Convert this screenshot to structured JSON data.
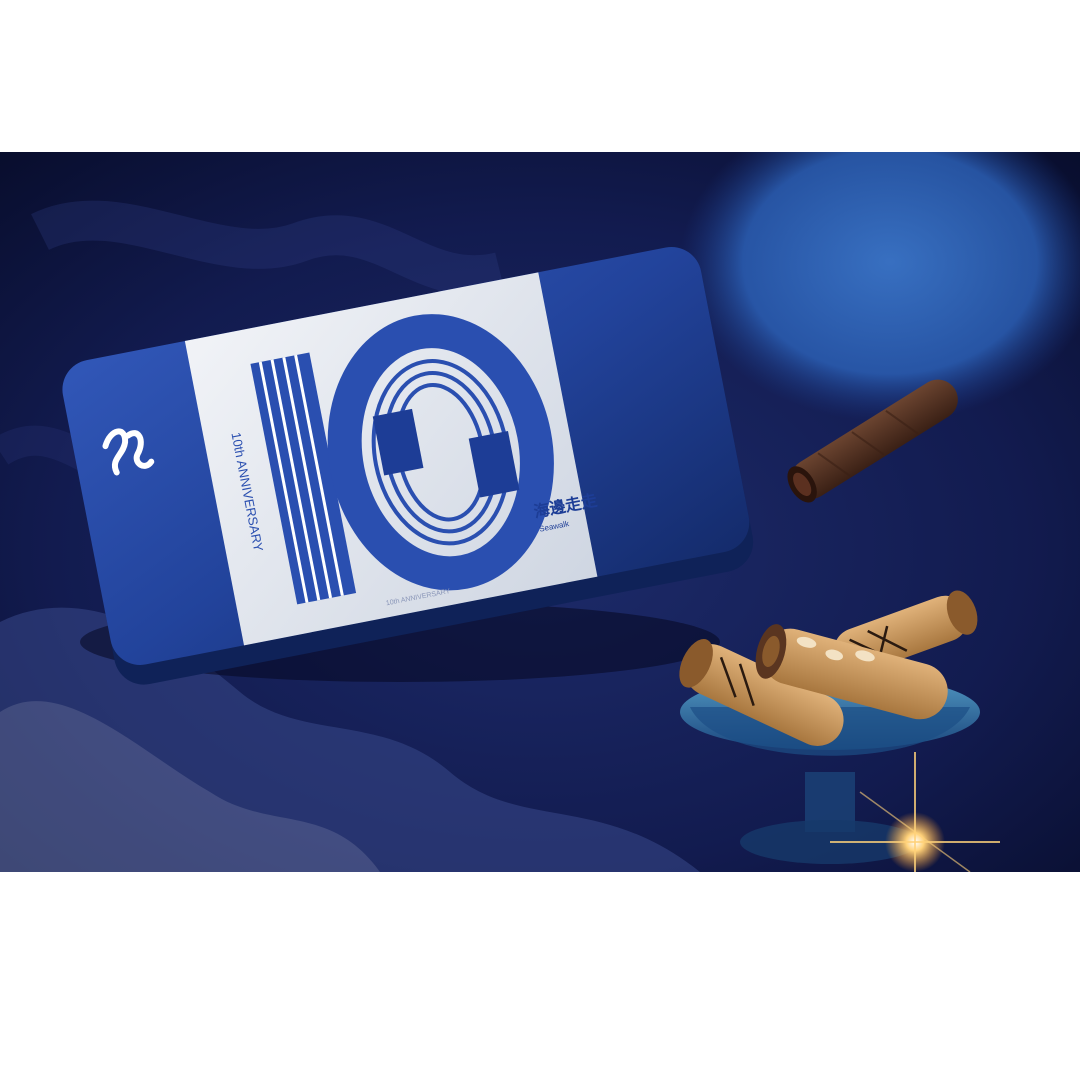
{
  "photo": {
    "alt": "",
    "tin": {
      "anniversary_text": "10th ANNIVERSARY",
      "brand_cn": "海邊走走",
      "brand_en": "Seawalk",
      "bottom_text": "10th ANNIVERSARY",
      "number": "10"
    },
    "colors": {
      "backdrop": "#0f1a4a",
      "tin_blue": "#1e3a8a",
      "sleeve": "#e9edf3",
      "cookie": "#c89a63",
      "choco_roll": "#4a2a1a",
      "bowl": "#2b6fa8",
      "sparkle": "#ffd27a"
    }
  }
}
